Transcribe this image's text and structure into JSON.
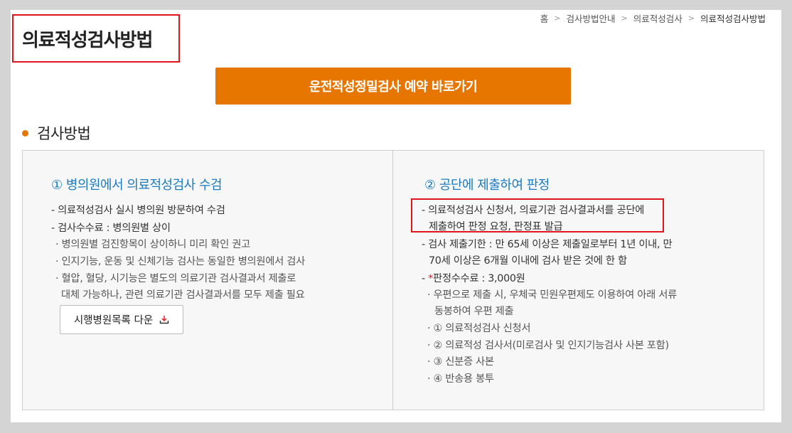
{
  "breadcrumb": {
    "items": [
      "홈",
      "검사방법안내",
      "의료적성검사",
      "의료적성검사방법"
    ],
    "separator": ">"
  },
  "page_title": "의료적성검사방법",
  "reserve_button": "운전적성정밀검사 예약 바로가기",
  "section_title": "검사방법",
  "left": {
    "title": "① 병의원에서 의료적성검사 수검",
    "lines": [
      "- 의료적성검사 실시 병의원 방문하여 수검",
      "- 검사수수료 : 병의원별 상이",
      "· 병의원별 검진항목이 상이하니 미리 확인 권고",
      "· 인지기능, 운동 및 신체기능 검사는 동일한 병의원에서 검사",
      "· 혈압, 혈당, 시기능은 별도의 의료기관 검사결과서 제출로",
      "대체 가능하나, 관련 의료기관 검사결과서를 모두 제출 필요"
    ],
    "download_button": "시행병원목록 다운"
  },
  "right": {
    "title": "② 공단에 제출하여 판정",
    "lines": [
      "- 의료적성검사 신청서, 의료기관 검사결과서를 공단에",
      "제출하여 판정 요청, 판정표 발급",
      "- 검사 제출기한 : 만 65세 이상은 제출일로부터 1년 이내, 만",
      "70세 이상은 6개월 이내에 검사 받은 것에 한 함"
    ],
    "fee_prefix": "- ",
    "fee_mark": "*",
    "fee_text": "판정수수료 : 3,000원",
    "sub_lines": [
      "· 우편으로 제출 시, 우체국 민원우편제도 이용하여 아래 서류",
      "동봉하여 우편 제출",
      "· ① 의료적성검사 신청서",
      "· ② 의료적성 검사서(미로검사 및 인지기능검사 사본 포함)",
      "· ③ 신분증 사본",
      "· ④ 반송용 봉투"
    ]
  },
  "colors": {
    "accent": "#e77600",
    "title_blue": "#1a7bc0",
    "highlight_red": "#e0161d"
  },
  "icons": {
    "download": "download-icon",
    "breadcrumb_sep": "chevron-right-icon"
  }
}
